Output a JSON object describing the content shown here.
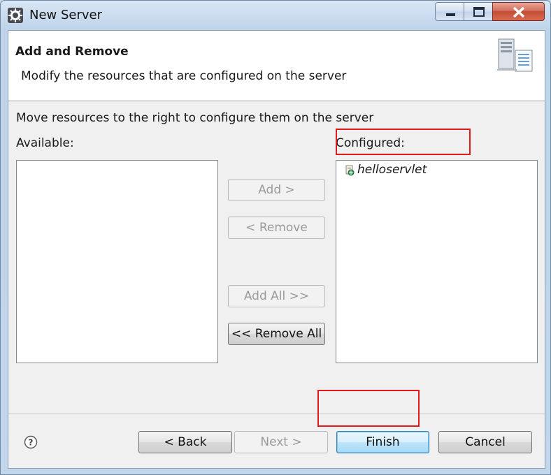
{
  "window": {
    "title": "New Server"
  },
  "header": {
    "title": "Add and Remove",
    "description": "Modify the resources that are configured on the server",
    "icon": "server-wizard-icon"
  },
  "body": {
    "instruction": "Move resources to the right to configure them on the server",
    "available_label": "Available:",
    "configured_label": "Configured:",
    "available_items": [],
    "configured_items": [
      {
        "label": "helloservlet",
        "icon": "web-module-icon"
      }
    ]
  },
  "buttons": {
    "add": "Add >",
    "remove": "< Remove",
    "add_all": "Add All >>",
    "remove_all": "<< Remove All",
    "back": "< Back",
    "next": "Next >",
    "finish": "Finish",
    "cancel": "Cancel",
    "help": "?"
  },
  "colors": {
    "highlight": "#e01a1a",
    "window_frame": "#c6d7ea",
    "dialog_bg": "#f0f0f0"
  }
}
